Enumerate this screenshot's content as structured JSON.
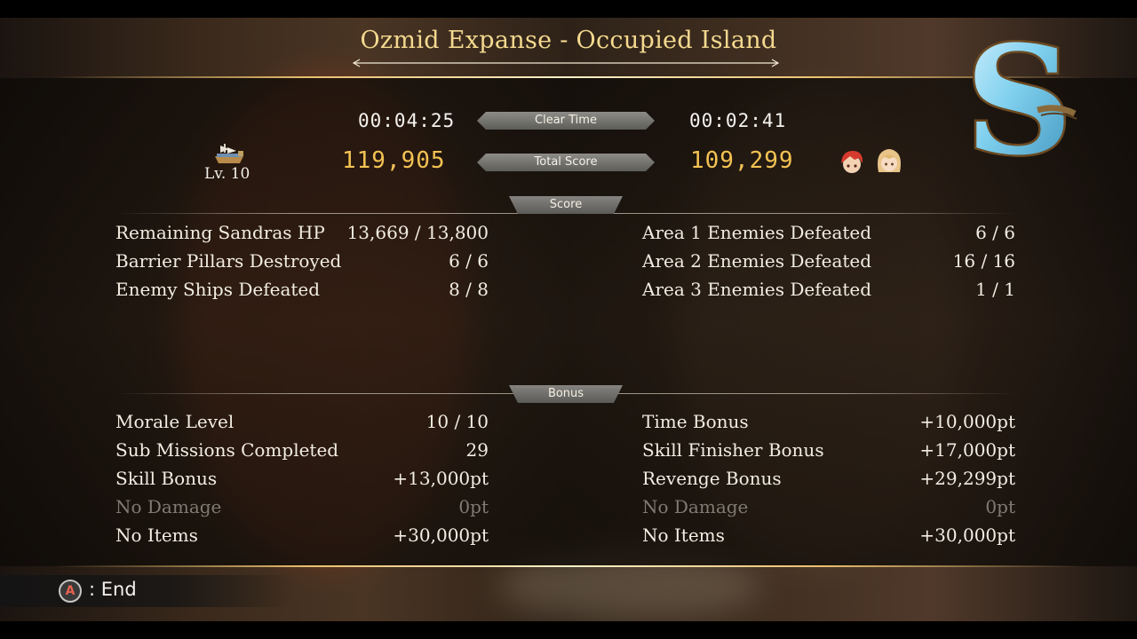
{
  "title": "Ozmid Expanse - Occupied Island",
  "party_level": "Lv. 10",
  "headers": {
    "clear_time": "Clear Time",
    "total_score": "Total Score"
  },
  "player": {
    "clear_time": "00:04:25",
    "total_score": "119,905"
  },
  "rival": {
    "clear_time": "00:02:41",
    "total_score": "109,299"
  },
  "rank": "S",
  "sections": {
    "score": "Score",
    "bonus": "Bonus"
  },
  "score_left": [
    {
      "label": "Remaining Sandras HP",
      "value": "13,669 / 13,800"
    },
    {
      "label": "Barrier Pillars Destroyed",
      "value": "6 / 6"
    },
    {
      "label": "Enemy Ships Defeated",
      "value": "8 / 8"
    }
  ],
  "score_right": [
    {
      "label": "Area 1 Enemies Defeated",
      "value": "6 / 6"
    },
    {
      "label": "Area 2 Enemies Defeated",
      "value": "16 / 16"
    },
    {
      "label": "Area 3 Enemies Defeated",
      "value": "1 / 1"
    }
  ],
  "bonus_left": [
    {
      "label": "Morale Level",
      "value": "10 / 10",
      "achieved": true
    },
    {
      "label": "Sub Missions Completed",
      "value": "29",
      "achieved": true
    },
    {
      "label": "Skill Bonus",
      "value": "+13,000pt",
      "achieved": true
    },
    {
      "label": "No Damage",
      "value": "0pt",
      "achieved": false
    },
    {
      "label": "No Items",
      "value": "+30,000pt",
      "achieved": true
    }
  ],
  "bonus_right": [
    {
      "label": "Time Bonus",
      "value": "+10,000pt",
      "achieved": true
    },
    {
      "label": "Skill Finisher Bonus",
      "value": "+17,000pt",
      "achieved": true
    },
    {
      "label": "Revenge Bonus",
      "value": "+29,299pt",
      "achieved": true
    },
    {
      "label": "No Damage",
      "value": "0pt",
      "achieved": false
    },
    {
      "label": "No Items",
      "value": "+30,000pt",
      "achieved": true
    }
  ],
  "footer": {
    "button_glyph": "A",
    "action_label": ": End"
  },
  "colors": {
    "title_gold": "#f4d98f",
    "score_gold": "#f3c253",
    "dim_text": "#7f7a72",
    "rank_blue": "#7fd0ee",
    "button_red": "#e8614f"
  },
  "icons": {
    "ship": "airship-icon",
    "rank": "rank-s-emblem",
    "rival_avatars": [
      "red-haired-character-avatar",
      "blonde-character-avatar"
    ],
    "confirm_button": "a-button-icon"
  }
}
